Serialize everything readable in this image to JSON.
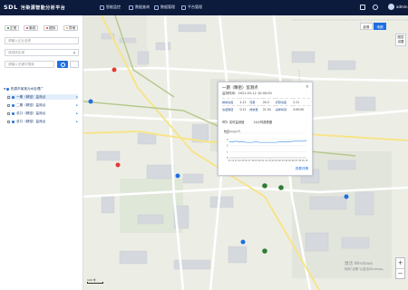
{
  "app": {
    "logo": "SDL",
    "title": "污染源智能分析平台",
    "user": "admin"
  },
  "nav": [
    {
      "label": "智能监控",
      "icon": "monitor-icon"
    },
    {
      "label": "数据查询",
      "icon": "table-icon"
    },
    {
      "label": "数据管理",
      "icon": "database-icon"
    },
    {
      "label": "平台管理",
      "icon": "settings-icon"
    }
  ],
  "sidebar": {
    "filters": [
      {
        "label": "正常",
        "color": "#2e7d32"
      },
      {
        "label": "离线",
        "color": "#d32f2f"
      },
      {
        "label": "超标",
        "color": "#e53935"
      },
      {
        "label": "异常",
        "color": "#f9a825"
      }
    ],
    "search1_placeholder": "请输入企业名称",
    "select_value": "请选择区域",
    "search2_placeholder": "请输入关键字搜索",
    "tree": [
      {
        "label": "阳泉市某某污水处理厂",
        "level": 0,
        "selected": false
      },
      {
        "label": "一期（精密）监测点",
        "level": 1,
        "selected": true
      },
      {
        "label": "二期（精密）监测点",
        "level": 1,
        "selected": true
      },
      {
        "label": "总口（精密）监测点",
        "level": 1,
        "selected": false
      },
      {
        "label": "总口（精密）监测点",
        "level": 1,
        "selected": false
      }
    ]
  },
  "map_controls": {
    "btn_map": "影像",
    "btn_layer": "地图",
    "btn_legend": "图层",
    "btn_legend2": "设置"
  },
  "popup": {
    "title": "一期（精密）监测点",
    "time": "监测时间：2021-03-12 10:00:00",
    "rows": [
      [
        "排放浓度",
        "2.11",
        "流量",
        "24.3",
        "折算浓度",
        "2.11"
      ],
      [
        "浓度限值",
        "0.11",
        "排放量",
        "21.54",
        "采样时间",
        "2:00:00"
      ]
    ],
    "switch_label": "实时监测值",
    "chart_title": "24小时趋势图",
    "y_label": "数值(mg/m³)",
    "more": "查看详情"
  },
  "chart_data": {
    "type": "line",
    "x": [
      "11",
      "12",
      "13",
      "14",
      "15",
      "16",
      "17",
      "18",
      "19",
      "20",
      "21",
      "22",
      "23",
      "00",
      "01",
      "02",
      "03",
      "04",
      "05",
      "06",
      "07",
      "08",
      "09",
      "10"
    ],
    "series": [
      {
        "values": [
          2.6,
          2.6,
          2.7,
          2.6,
          2.6,
          2.5,
          2.5,
          2.5,
          2.6,
          2.5,
          2.5,
          2.5,
          2.5,
          2.5,
          2.5,
          2.6,
          2.6,
          2.6,
          2.6,
          2.7,
          2.7,
          2.7,
          2.7,
          2.8
        ]
      }
    ],
    "yticks": [
      "0",
      "1",
      "2",
      "3",
      "4"
    ],
    "ylim": [
      0,
      4
    ],
    "series_color": "#3a8ee6"
  },
  "watermark": {
    "line1": "激活 Windows",
    "line2": "转到\"设置\"以激活Windows。"
  },
  "scale": "100 米"
}
